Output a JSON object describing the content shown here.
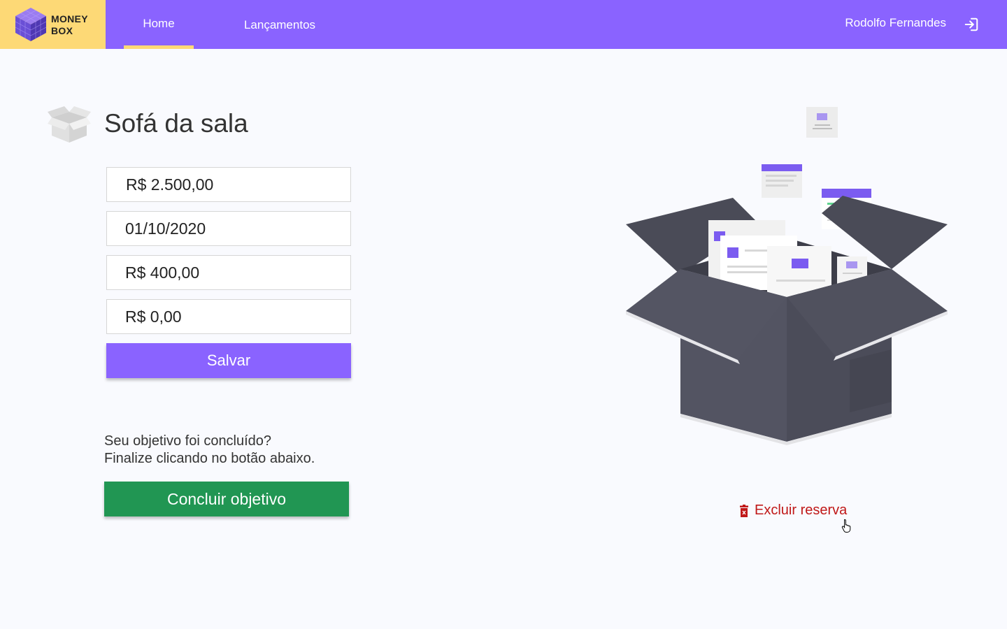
{
  "brand": {
    "line1": "MONEY",
    "line2": "BOX"
  },
  "nav": {
    "home": "Home",
    "lancamentos": "Lançamentos"
  },
  "user": {
    "name": "Rodolfo Fernandes"
  },
  "goal": {
    "title": "Sofá da sala",
    "fields": {
      "target": "R$ 2.500,00",
      "date": "01/10/2020",
      "monthly": "R$ 400,00",
      "saved": "R$ 0,00"
    },
    "save_label": "Salvar"
  },
  "finish": {
    "line1": "Seu objetivo foi concluído?",
    "line2": "Finalize clicando no botão abaixo.",
    "button_label": "Concluir objetivo"
  },
  "delete_label": "Excluir reserva",
  "colors": {
    "primary": "#8a63ff",
    "accent": "#fdd976",
    "success": "#219653",
    "danger": "#c01818"
  }
}
